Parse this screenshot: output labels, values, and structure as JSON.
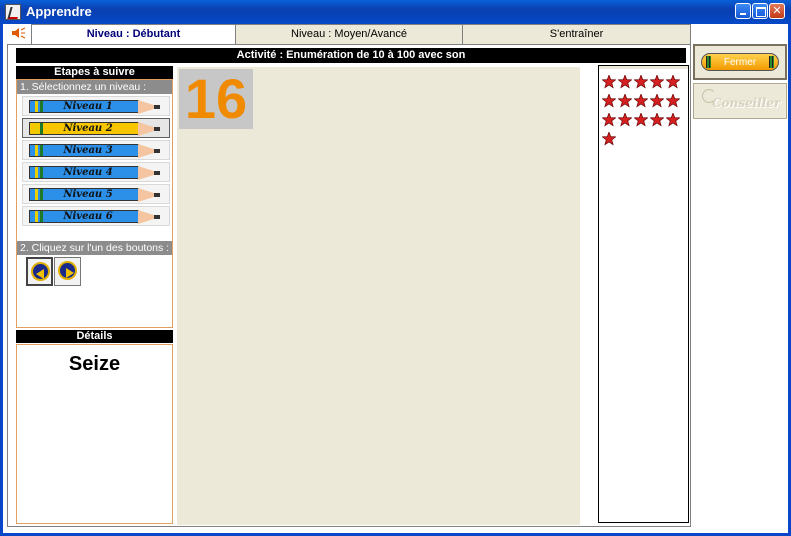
{
  "window": {
    "title": "Apprendre"
  },
  "tabs": [
    {
      "label": "Niveau : Débutant",
      "active": true
    },
    {
      "label": "Niveau : Moyen/Avancé",
      "active": false
    },
    {
      "label": "S'entraîner",
      "active": false
    }
  ],
  "activity": {
    "title": "Activité : Enumération de 10 à 100 avec son"
  },
  "steps": {
    "header": "Etapes à suivre",
    "step1_label": "1. Sélectionnez un niveau :",
    "step2_label": "2. Cliquez sur l'un des boutons :",
    "levels": [
      {
        "label": "Niveau 1",
        "color": "#2c8fe8",
        "selected": false
      },
      {
        "label": "Niveau 2",
        "color": "#f7c600",
        "selected": true
      },
      {
        "label": "Niveau 3",
        "color": "#2c8fe8",
        "selected": false
      },
      {
        "label": "Niveau 4",
        "color": "#2c8fe8",
        "selected": false
      },
      {
        "label": "Niveau 5",
        "color": "#2c8fe8",
        "selected": false
      },
      {
        "label": "Niveau 6",
        "color": "#2c8fe8",
        "selected": false
      }
    ]
  },
  "details": {
    "header": "Détails",
    "text": "Seize"
  },
  "display": {
    "number": "16",
    "number_color": "#f08a00"
  },
  "stars": {
    "count": 16,
    "color": "#d42020",
    "per_row": 5
  },
  "side_buttons": {
    "fermer_label": "Fermer",
    "conseiller_label": "Conseiller"
  }
}
